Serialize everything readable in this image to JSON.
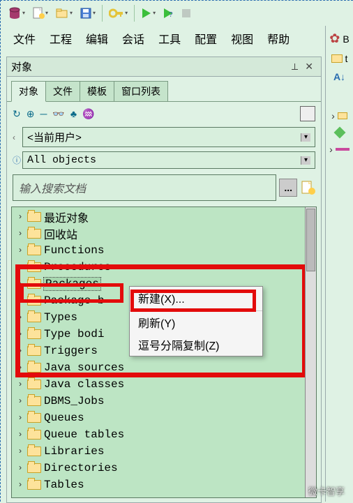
{
  "toolbar": {
    "icons": [
      "db-icon",
      "new-doc-icon",
      "open-icon",
      "save-icon",
      "key-icon",
      "play-icon",
      "help-icon",
      "stop-icon"
    ]
  },
  "menubar": {
    "items": [
      "文件",
      "工程",
      "编辑",
      "会话",
      "工具",
      "配置",
      "视图",
      "帮助"
    ]
  },
  "rstrip": {
    "lbl_b": "B",
    "lbl_t": "t"
  },
  "panel": {
    "title": "对象",
    "tabs": [
      "对象",
      "文件",
      "模板",
      "窗口列表"
    ],
    "mini_icons": [
      "refresh-icon",
      "plus-icon",
      "minus-icon",
      "binoculars-icon",
      "hierarchy-icon",
      "link-icon"
    ],
    "user_dropdown": "<当前用户>",
    "scope_dropdown": "All objects",
    "search_placeholder": "输入搜索文档",
    "dots": "..."
  },
  "tree": {
    "items": [
      {
        "label": "最近对象"
      },
      {
        "label": "回收站"
      },
      {
        "label": "Functions"
      },
      {
        "label": "Procedures"
      },
      {
        "label": "Packages",
        "selected": true
      },
      {
        "label": "Package bodies",
        "clip": "Package b"
      },
      {
        "label": "Types"
      },
      {
        "label": "Type bodies",
        "clip": "Type bodi"
      },
      {
        "label": "Triggers"
      },
      {
        "label": "Java sources",
        "clip": "Java sources"
      },
      {
        "label": "Java classes"
      },
      {
        "label": "DBMS_Jobs"
      },
      {
        "label": "Queues"
      },
      {
        "label": "Queue tables"
      },
      {
        "label": "Libraries"
      },
      {
        "label": "Directories"
      },
      {
        "label": "Tables"
      }
    ]
  },
  "context_menu": {
    "items": [
      "新建(X)...",
      "刷新(Y)",
      "逗号分隔复制(Z)"
    ]
  },
  "watermark": "微卡智享"
}
